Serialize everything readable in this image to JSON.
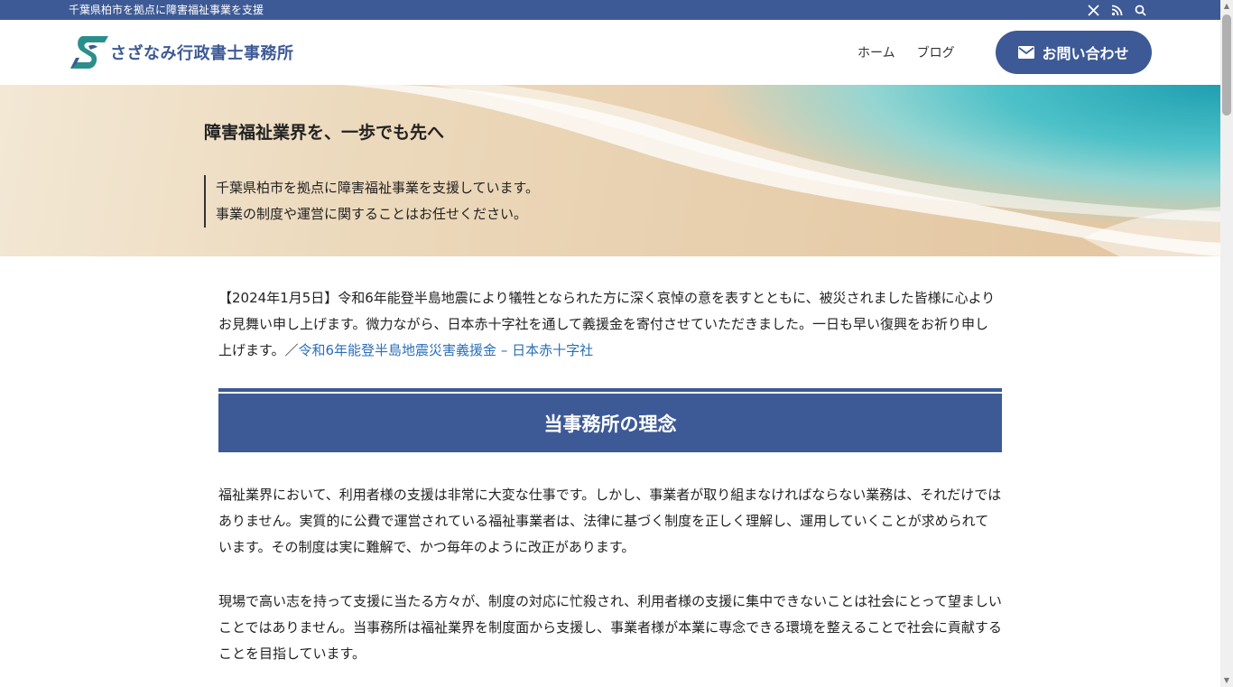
{
  "topbar": {
    "tagline": "千葉県柏市を拠点に障害福祉事業を支援",
    "icons": [
      "x-icon",
      "rss-icon",
      "search-icon"
    ]
  },
  "header": {
    "site_name": "さざなみ行政書士事務所",
    "nav": [
      {
        "label": "ホーム"
      },
      {
        "label": "ブログ"
      }
    ],
    "contact_label": "お問い合わせ",
    "brand_color": "#3d5a96"
  },
  "hero": {
    "title": "障害福祉業界を、一歩でも先へ",
    "sub_line1": "千葉県柏市を拠点に障害福祉事業を支援しています。",
    "sub_line2": "事業の制度や運営に関することはお任せください。"
  },
  "notice": {
    "text": "【2024年1月5日】令和6年能登半島地震により犠牲となられた方に深く哀悼の意を表すとともに、被災されました皆様に心よりお見舞い申し上げます。微力ながら、日本赤十字社を通して義援金を寄付させていただきました。一日も早い復興をお祈り申し上げます。／",
    "link_text": "令和6年能登半島地震災害義援金 – 日本赤十字社",
    "link_color": "#2a6fb8"
  },
  "philosophy": {
    "heading": "当事務所の理念",
    "para1": "福祉業界において、利用者様の支援は非常に大変な仕事です。しかし、事業者が取り組まなければならない業務は、それだけではありません。実質的に公費で運営されている福祉事業者は、法律に基づく制度を正しく理解し、運用していくことが求められています。その制度は実に難解で、かつ毎年のように改正があります。",
    "para2": "現場で高い志を持って支援に当たる方々が、制度の対応に忙殺され、利用者様の支援に集中できないことは社会にとって望ましいことではありません。当事務所は福祉業界を制度面から支援し、事業者様が本業に専念できる環境を整えることで社会に貢献することを目指しています。"
  }
}
